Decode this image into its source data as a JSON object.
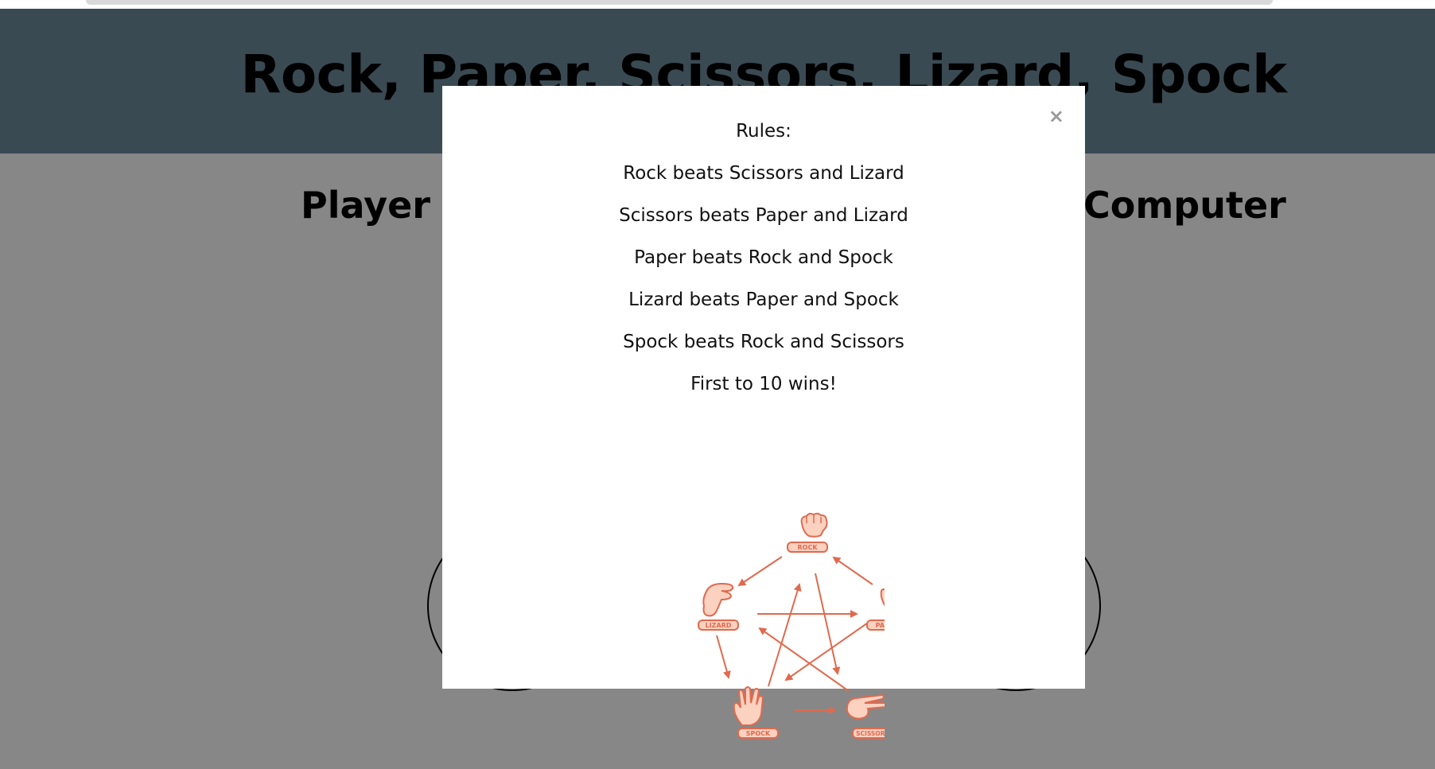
{
  "page": {
    "title": "Rock, Paper, Scissors, Lizard, Spock",
    "player_label": "Player",
    "computer_label": "Computer"
  },
  "modal": {
    "close_label": "×",
    "rules": [
      "Rules:",
      "Rock beats Scissors and Lizard",
      "Scissors beats Paper and Lizard",
      "Paper beats Rock and Spock",
      "Lizard beats Paper and Spock",
      "Spock beats Rock and Scissors",
      "First to 10 wins!"
    ],
    "diagram": {
      "labels": {
        "rock": "ROCK",
        "paper": "PAPER",
        "scissors": "SCISSORS",
        "spock": "SPOCK",
        "lizard": "LIZARD"
      },
      "accent_color": "#e06a4e",
      "fill_color": "#fbd1c0"
    }
  },
  "colors": {
    "header_bg": "#3a4a53",
    "overlay_bg": "#878787",
    "modal_bg": "#ffffff"
  }
}
